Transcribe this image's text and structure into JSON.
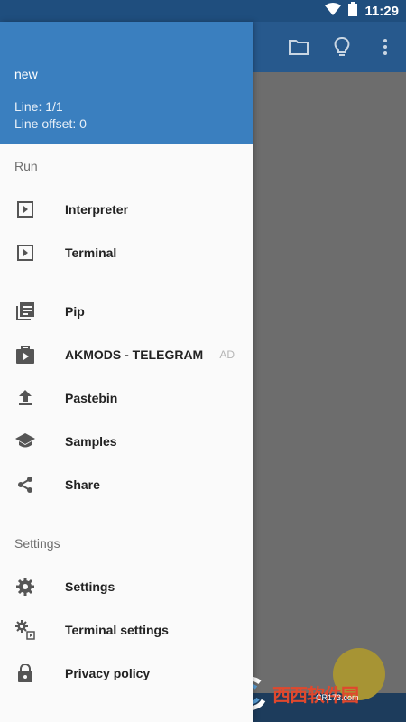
{
  "status_bar": {
    "time": "11:29"
  },
  "drawer": {
    "header": {
      "file_name": "new",
      "line": "Line: 1/1",
      "line_offset": "Line offset: 0"
    },
    "sections": {
      "run_label": "Run",
      "settings_label": "Settings"
    },
    "items": {
      "interpreter": "Interpreter",
      "terminal": "Terminal",
      "pip": "Pip",
      "akmods": "AKMODS - TELEGRAM",
      "akmods_badge": "AD",
      "pastebin": "Pastebin",
      "samples": "Samples",
      "share": "Share",
      "settings": "Settings",
      "terminal_settings": "Terminal settings",
      "privacy_policy": "Privacy policy"
    }
  },
  "watermark": {
    "main": "西西软件园",
    "sub": "CR173.com"
  },
  "colors": {
    "header": "#3a7fbf",
    "appbar": "#27598d",
    "statusbar": "#1f4e7e",
    "fab": "#a79434"
  }
}
